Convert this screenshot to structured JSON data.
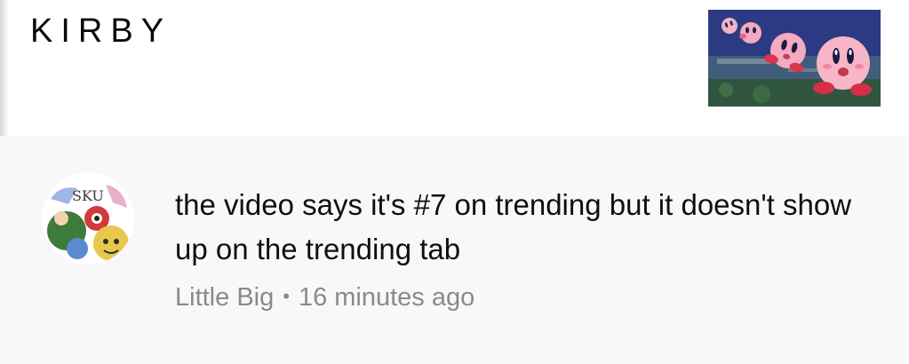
{
  "header": {
    "title": "KIRBY",
    "thumbnail_icon": "kirby-thumbnail"
  },
  "comment": {
    "avatar_icon": "user-avatar",
    "avatar_logo_text": "SKU",
    "text": "the video says it's #7 on trending but it doesn't show up on the trending tab",
    "author": "Little Big",
    "separator": "•",
    "timestamp": "16 minutes ago"
  },
  "colors": {
    "text_primary": "#0f0f0f",
    "text_secondary": "#8a8a8a",
    "background": "#f8f8f8",
    "kirby_pink": "#f2a3b8"
  }
}
